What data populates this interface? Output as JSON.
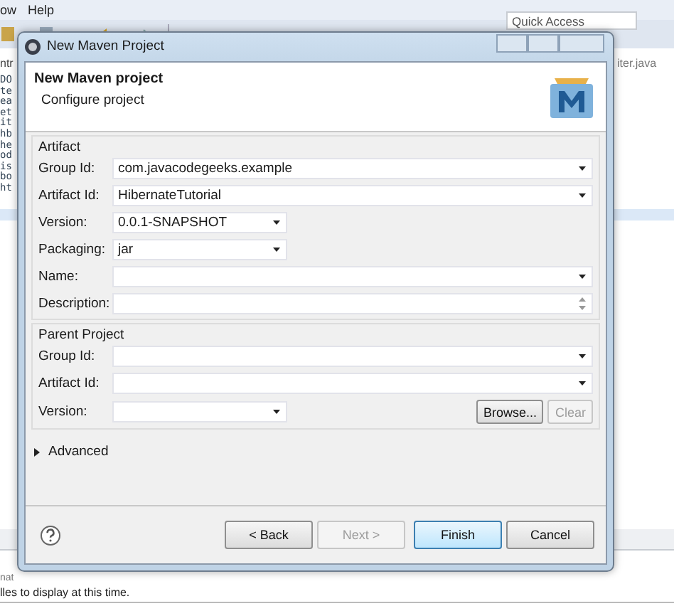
{
  "ide": {
    "menu": [
      "ow",
      "Help"
    ],
    "quick_access": {
      "placeholder": "Quick Access"
    },
    "left_tab": "ntr",
    "editor_tab": "iter.java",
    "code_lines": [
      "DO",
      "te",
      "ea",
      "et",
      "it",
      "hb",
      "he",
      "od",
      "is",
      "bo",
      "ht"
    ],
    "panel_tab": "nat",
    "status_message": "lles to display at this time."
  },
  "dialog": {
    "title": "New Maven Project",
    "heading": "New Maven project",
    "subtitle": "Configure project",
    "artifact": {
      "label": "Artifact",
      "fields": [
        {
          "label": "Group Id:",
          "value": "com.javacodegeeks.example",
          "kind": "combo"
        },
        {
          "label": "Artifact Id:",
          "value": "HibernateTutorial",
          "kind": "combo"
        },
        {
          "label": "Version:",
          "value": "0.0.1-SNAPSHOT",
          "kind": "short-combo"
        },
        {
          "label": "Packaging:",
          "value": "jar",
          "kind": "short-combo"
        },
        {
          "label": "Name:",
          "kind": "combo"
        },
        {
          "label": "Description:",
          "kind": "memo"
        }
      ]
    },
    "parent": {
      "label": "Parent Project",
      "fields": [
        {
          "label": "Group Id:",
          "kind": "combo"
        },
        {
          "label": "Artifact Id:",
          "kind": "combo"
        },
        {
          "label": "Version:",
          "kind": "short-combo"
        }
      ],
      "buttons": [
        {
          "label": "Browse...",
          "disabled": false
        },
        {
          "label": "Clear",
          "disabled": true
        }
      ]
    },
    "advanced": {
      "label": "Advanced",
      "expanded": false
    },
    "buttons": [
      {
        "label": "< Back",
        "disabled": false,
        "default": false
      },
      {
        "label": "Next >",
        "disabled": true,
        "default": false
      },
      {
        "label": "Finish",
        "disabled": false,
        "default": true
      },
      {
        "label": "Cancel",
        "disabled": false,
        "default": false
      }
    ]
  }
}
